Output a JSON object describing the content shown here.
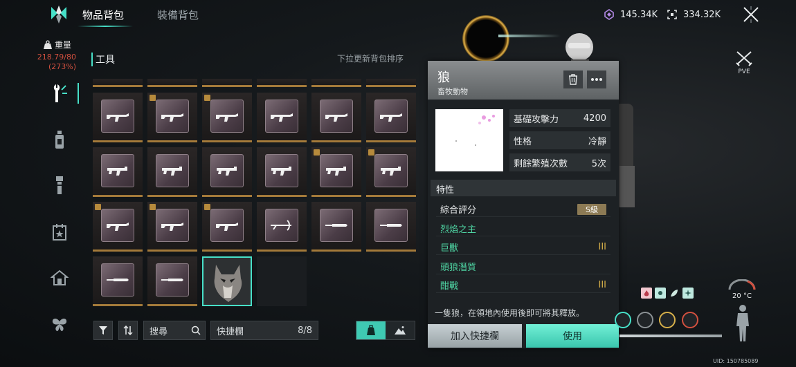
{
  "tabs": [
    {
      "label": "物品背包",
      "active": true
    },
    {
      "label": "裝備背包",
      "active": false
    }
  ],
  "currency": [
    {
      "icon": "crystal-icon",
      "value": "145.34K"
    },
    {
      "icon": "frame-icon",
      "value": "334.32K"
    }
  ],
  "weight": {
    "label": "重量",
    "value": "218.79/80",
    "percent": "(273%)"
  },
  "sidebar": [
    {
      "name": "tools",
      "icon": "wrench-icon",
      "active": true
    },
    {
      "name": "consumables",
      "icon": "bottle-icon",
      "active": false
    },
    {
      "name": "materials",
      "icon": "flashlight-icon",
      "active": false
    },
    {
      "name": "quests",
      "icon": "calendar-star-icon",
      "active": false
    },
    {
      "name": "housing",
      "icon": "house-icon",
      "active": false
    },
    {
      "name": "creatures",
      "icon": "butterfly-icon",
      "active": false
    }
  ],
  "section": {
    "title": "工具",
    "sort_hint": "下拉更新背包排序"
  },
  "grid": [
    {
      "type": "rifle",
      "badge": false
    },
    {
      "type": "rifle",
      "badge": true
    },
    {
      "type": "rifle",
      "badge": true
    },
    {
      "type": "rifle",
      "badge": false
    },
    {
      "type": "rifle",
      "badge": false
    },
    {
      "type": "rifle",
      "badge": false
    },
    {
      "type": "smg",
      "badge": false
    },
    {
      "type": "smg",
      "badge": false
    },
    {
      "type": "smg",
      "badge": false
    },
    {
      "type": "smg",
      "badge": false
    },
    {
      "type": "smg",
      "badge": true
    },
    {
      "type": "smg",
      "badge": true
    },
    {
      "type": "rifle",
      "badge": true
    },
    {
      "type": "rifle",
      "badge": true
    },
    {
      "type": "rifle",
      "badge": true
    },
    {
      "type": "crossbow",
      "badge": false
    },
    {
      "type": "knife",
      "badge": false
    },
    {
      "type": "knife",
      "badge": false
    },
    {
      "type": "knife",
      "badge": false
    },
    {
      "type": "knife",
      "badge": false
    },
    {
      "type": "wolf",
      "badge": false,
      "selected": true
    },
    {
      "type": "empty",
      "badge": false
    }
  ],
  "toolbar": {
    "search_label": "搜尋",
    "quickbar_label": "快捷欄",
    "quickbar_count": "8/8"
  },
  "detail": {
    "title": "狼",
    "subtitle": "畜牧動物",
    "stats": [
      {
        "label": "基礎攻擊力",
        "value": "4200"
      },
      {
        "label": "性格",
        "value": "冷靜"
      },
      {
        "label": "剩餘繁殖次數",
        "value": "5次"
      }
    ],
    "traits_title": "特性",
    "traits": [
      {
        "label": "綜合評分",
        "value": "S級",
        "kind": "grade"
      },
      {
        "label": "烈焰之主",
        "value": "",
        "kind": "green"
      },
      {
        "label": "巨獸",
        "value": "III",
        "kind": "green"
      },
      {
        "label": "頭狼潛質",
        "value": "",
        "kind": "green"
      },
      {
        "label": "酣戰",
        "value": "III",
        "kind": "green"
      }
    ],
    "description": "一隻狼，在領地內使用後即可將其釋放。",
    "add_quick_label": "加入快捷欄",
    "use_label": "使用"
  },
  "hud": {
    "pve_label": "PVE",
    "temperature": "20 °C",
    "uid": "UID: 150785089"
  },
  "colors": {
    "accent": "#47e0c8",
    "warning": "#d2503f",
    "gold": "#d7b04a"
  }
}
